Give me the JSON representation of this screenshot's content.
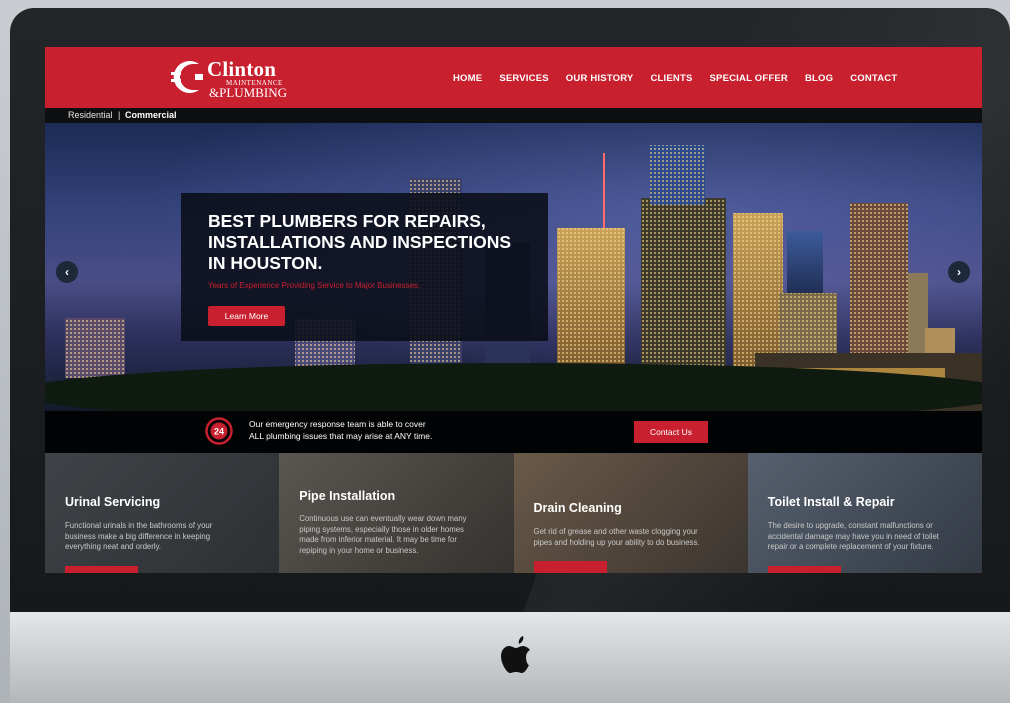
{
  "colors": {
    "brand_red": "#c8202f",
    "dark": "#0e0f11"
  },
  "logo": {
    "name": "Clinton",
    "sub_top": "MAINTENANCE",
    "sub_bottom": "&PLUMBING"
  },
  "nav": {
    "items": [
      "HOME",
      "SERVICES",
      "OUR HISTORY",
      "CLIENTS",
      "SPECIAL OFFER",
      "BLOG",
      "CONTACT"
    ]
  },
  "subnav": {
    "residential": "Residential",
    "separator": "|",
    "commercial": "Commercial"
  },
  "hero": {
    "title_lines": [
      "BEST PLUMBERS FOR REPAIRS,",
      "INSTALLATIONS AND INSPECTIONS",
      "IN HOUSTON."
    ],
    "subtitle": "Years of Experience Providing Service to Major Businesses.",
    "button": "Learn More",
    "prev_icon": "chevron-left-icon",
    "next_icon": "chevron-right-icon"
  },
  "emergency": {
    "icon": "24-hour-icon",
    "badge": "24",
    "line1": "Our emergency response team is able to cover",
    "line2": "ALL plumbing issues that may arise at ANY time.",
    "button": "Contact Us"
  },
  "services": [
    {
      "title": "Urinal Servicing",
      "desc": [
        "Functional urinals in the bathrooms of your",
        "business make a big difference in keeping",
        "everything neat and orderly."
      ]
    },
    {
      "title": "Pipe Installation",
      "desc": [
        "Continuous use can eventually wear down many",
        "piping systems, especially those in older homes",
        "made from inferior material. It may be time for",
        "repiping in your home or business."
      ]
    },
    {
      "title": "Drain Cleaning",
      "desc": [
        "Get rid of grease and other waste clogging your",
        "pipes and holding up your ability to do business."
      ]
    },
    {
      "title": "Toilet Install & Repair",
      "desc": [
        "The desire to upgrade, constant malfunctions or",
        "accidental damage may have you in need of toilet",
        "repair or a complete replacement of your fixture."
      ]
    }
  ]
}
